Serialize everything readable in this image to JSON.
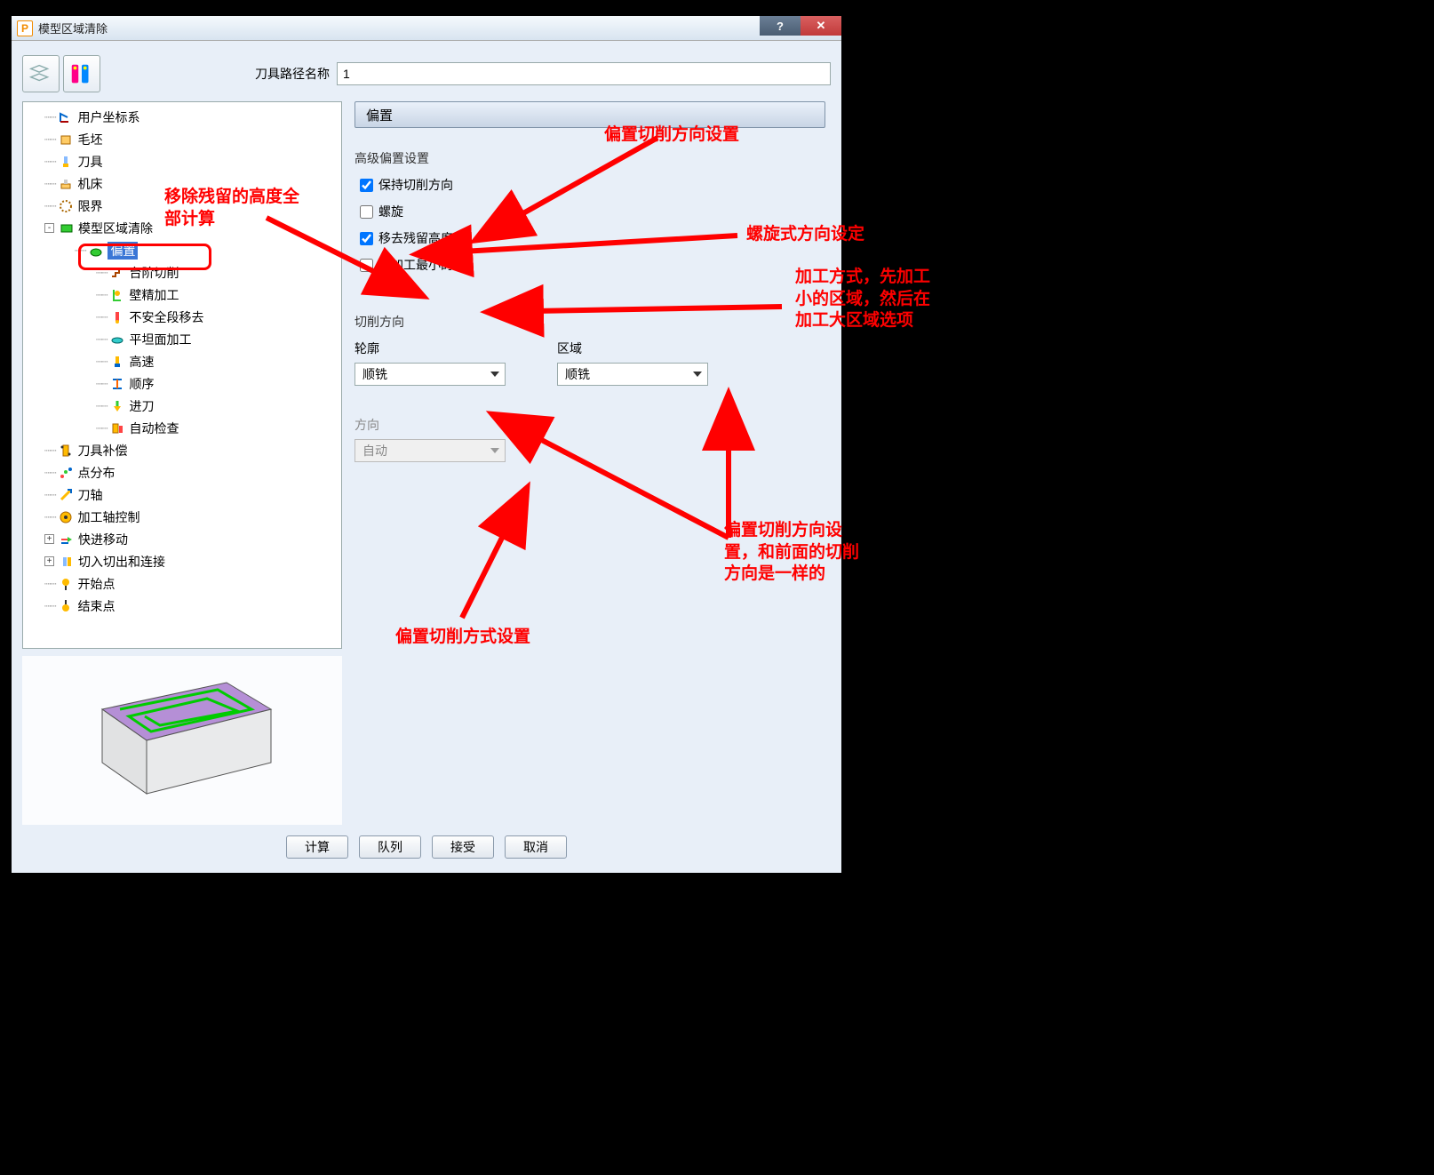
{
  "window": {
    "title": "模型区域清除",
    "app_icon_letter": "P"
  },
  "toolbar": {
    "path_label": "刀具路径名称",
    "path_value": "1"
  },
  "tree": {
    "items": [
      {
        "id": "ucs",
        "label": "用户坐标系",
        "depth": 1
      },
      {
        "id": "stock",
        "label": "毛坯",
        "depth": 1
      },
      {
        "id": "tool",
        "label": "刀具",
        "depth": 1
      },
      {
        "id": "machine",
        "label": "机床",
        "depth": 1
      },
      {
        "id": "boundary",
        "label": "限界",
        "depth": 1
      },
      {
        "id": "areaclear",
        "label": "模型区域清除",
        "depth": 1,
        "expander": "-"
      },
      {
        "id": "offset",
        "label": "偏置",
        "depth": 2,
        "selected": true
      },
      {
        "id": "stepcut",
        "label": "台阶切削",
        "depth": 3
      },
      {
        "id": "wall",
        "label": "壁精加工",
        "depth": 3
      },
      {
        "id": "unsafe",
        "label": "不安全段移去",
        "depth": 3
      },
      {
        "id": "flat",
        "label": "平坦面加工",
        "depth": 3
      },
      {
        "id": "highspeed",
        "label": "高速",
        "depth": 3
      },
      {
        "id": "order",
        "label": "顺序",
        "depth": 3
      },
      {
        "id": "approach",
        "label": "进刀",
        "depth": 3
      },
      {
        "id": "autocheck",
        "label": "自动检查",
        "depth": 3
      },
      {
        "id": "toolcomp",
        "label": "刀具补偿",
        "depth": 1
      },
      {
        "id": "ptdist",
        "label": "点分布",
        "depth": 1
      },
      {
        "id": "toolaxis",
        "label": "刀轴",
        "depth": 1
      },
      {
        "id": "axisctrl",
        "label": "加工轴控制",
        "depth": 1
      },
      {
        "id": "rapid",
        "label": "快进移动",
        "depth": 1,
        "expander": "+"
      },
      {
        "id": "leadlinks",
        "label": "切入切出和连接",
        "depth": 1,
        "expander": "+"
      },
      {
        "id": "start",
        "label": "开始点",
        "depth": 1
      },
      {
        "id": "end",
        "label": "结束点",
        "depth": 1
      }
    ]
  },
  "panel": {
    "title": "偏置",
    "group_advanced": "高级偏置设置",
    "chk_keepdir": "保持切削方向",
    "chk_spiral": "螺旋",
    "chk_removerest": "移去残留高度",
    "chk_smallfirst": "先加工最小的",
    "group_cutdir": "切削方向",
    "lbl_profile": "轮廓",
    "lbl_area": "区域",
    "combo_profile": "顺铣",
    "combo_area": "顺铣",
    "lbl_direction": "方向",
    "combo_direction": "自动"
  },
  "check_state": {
    "keepdir": true,
    "spiral": false,
    "removerest": true,
    "smallfirst": false
  },
  "buttons": {
    "calc": "计算",
    "queue": "队列",
    "accept": "接受",
    "cancel": "取消"
  },
  "annotations": {
    "a1": "偏置切削方向设置",
    "a2": "螺旋式方向设定",
    "a3": "加工方式，先加工\n小的区域，然后在\n加工大区域选项",
    "a4": "偏置切削方向设\n置，和前面的切削\n方向是一样的",
    "a5": "偏置切削方式设置",
    "a6": "移除残留的高度全\n部计算"
  }
}
